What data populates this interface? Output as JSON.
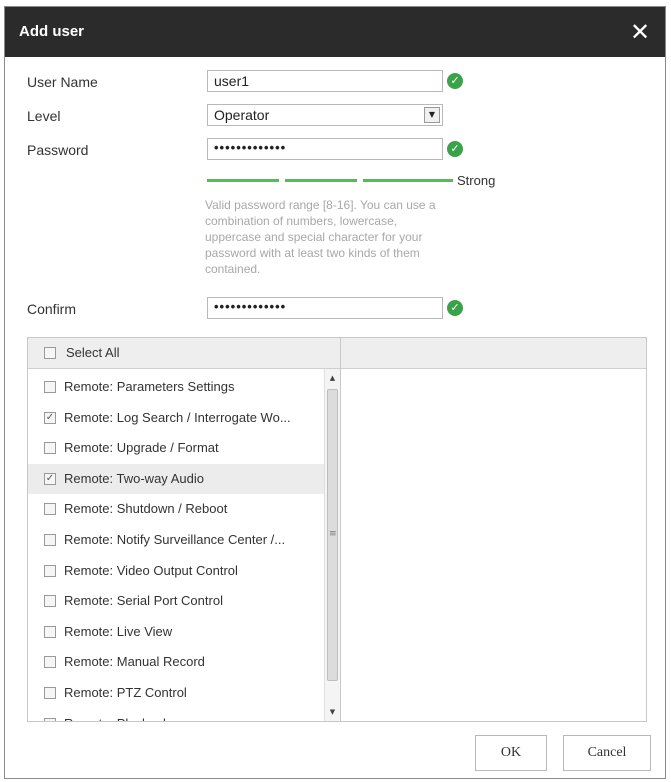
{
  "dialog": {
    "title": "Add user",
    "close_symbol": "✕"
  },
  "form": {
    "username_label": "User Name",
    "username_value": "user1",
    "level_label": "Level",
    "level_value": "Operator",
    "password_label": "Password",
    "password_value": "•••••••••••••",
    "strength_label": "Strong",
    "password_hint": "Valid password range [8-16]. You can use a combination of numbers, lowercase, uppercase and special character for your password with at least two kinds of them contained.",
    "confirm_label": "Confirm",
    "confirm_value": "•••••••••••••"
  },
  "permissions": {
    "select_all_label": "Select All",
    "items": [
      {
        "label": "Remote: Parameters Settings",
        "checked": false
      },
      {
        "label": "Remote: Log Search / Interrogate Wo...",
        "checked": true
      },
      {
        "label": "Remote: Upgrade / Format",
        "checked": false
      },
      {
        "label": "Remote: Two-way Audio",
        "checked": true,
        "highlighted": true
      },
      {
        "label": "Remote: Shutdown / Reboot",
        "checked": false
      },
      {
        "label": "Remote: Notify Surveillance Center /...",
        "checked": false
      },
      {
        "label": "Remote: Video Output Control",
        "checked": false
      },
      {
        "label": "Remote: Serial Port Control",
        "checked": false
      },
      {
        "label": "Remote: Live View",
        "checked": false
      },
      {
        "label": "Remote: Manual Record",
        "checked": false
      },
      {
        "label": "Remote: PTZ Control",
        "checked": false
      },
      {
        "label": "Remote: Playback",
        "checked": false
      }
    ]
  },
  "buttons": {
    "ok_label": "OK",
    "cancel_label": "Cancel"
  },
  "colors": {
    "title_bar": "#2b2b2b",
    "valid_icon": "#3aa34a",
    "strength_bar": "#5cb85c",
    "hint_text": "#a8a8a8"
  },
  "icons": {
    "valid": "check-circle-icon",
    "close": "close-icon",
    "dropdown": "triangle-down-icon"
  }
}
